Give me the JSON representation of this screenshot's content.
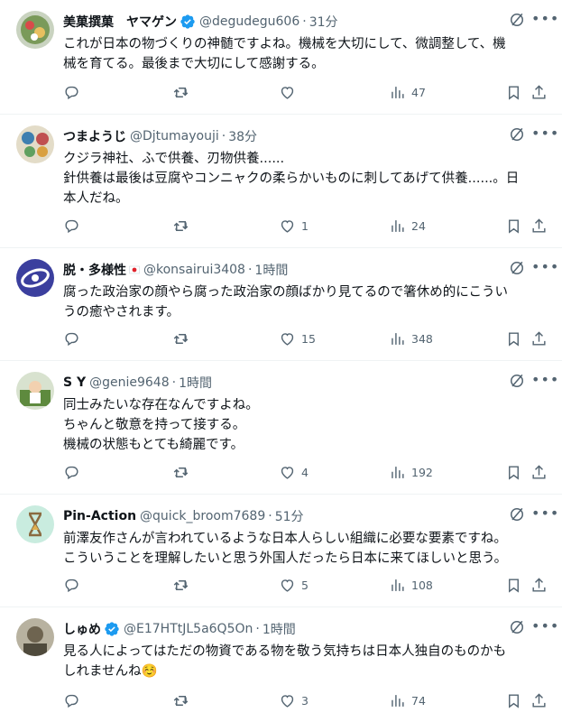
{
  "colors": {
    "text": "#0f1419",
    "secondary": "#536471",
    "verified": "#1d9bf0",
    "divider": "#eff3f4"
  },
  "icons": {
    "reply": "reply-icon",
    "retweet": "retweet-icon",
    "like": "heart-icon",
    "views": "views-icon",
    "bookmark": "bookmark-icon",
    "share": "share-icon",
    "grok": "grok-icon",
    "more": "more-icon"
  },
  "tweets": [
    {
      "name": "美菓撰菓　ヤマゲン",
      "handle": "@degudegu606",
      "time": "31分",
      "lines": [
        "これが日本の物づくりの神髄ですよね。機械を大切にして、微調整して、機",
        "械を育てる。最後まで大切にして感謝する。"
      ],
      "replies": "",
      "retweets": "",
      "likes": "",
      "views": "47"
    },
    {
      "name": "つまようじ",
      "handle": "@Djtumayouji",
      "time": "38分",
      "lines": [
        "クジラ神社、ふで供養、刃物供養......",
        "針供養は最後は豆腐やコンニャクの柔らかいものに刺してあげて供養......。日",
        "本人だね。"
      ],
      "replies": "",
      "retweets": "",
      "likes": "1",
      "views": "24"
    },
    {
      "name": "脱・多様性",
      "handle": "@konsairui3408",
      "time": "1時間",
      "lines": [
        "腐った政治家の顔やら腐った政治家の顔ばかり見てるので箸休め的にこうい",
        "うの癒やされます。"
      ],
      "replies": "",
      "retweets": "",
      "likes": "15",
      "views": "348"
    },
    {
      "name": "S Y",
      "handle": "@genie9648",
      "time": "1時間",
      "lines": [
        "同士みたいな存在なんですよね。",
        "ちゃんと敬意を持って接する。",
        "機械の状態もとても綺麗です。"
      ],
      "replies": "",
      "retweets": "",
      "likes": "4",
      "views": "192"
    },
    {
      "name": "Pin-Action",
      "handle": "@quick_broom7689",
      "time": "51分",
      "lines": [
        "前澤友作さんが言われているような日本人らしい組織に必要な要素ですね。",
        "こういうことを理解したいと思う外国人だったら日本に来てほしいと思う。"
      ],
      "replies": "",
      "retweets": "",
      "likes": "5",
      "views": "108"
    },
    {
      "name": "しゅめ",
      "handle": "@E17HTtJL5a6Q5On",
      "time": "1時間",
      "lines": [
        "見る人によってはただの物資である物を敬う気持ちは日本人独自のものかも",
        "しれませんね☺️"
      ],
      "replies": "",
      "retweets": "",
      "likes": "3",
      "views": "74"
    }
  ]
}
